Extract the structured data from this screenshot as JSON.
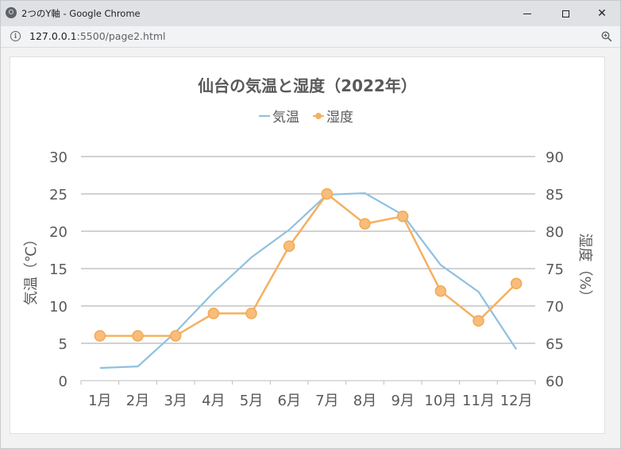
{
  "window": {
    "title": "2つのY軸 - Google Chrome",
    "minimize_glyph": "",
    "close_glyph": "✕"
  },
  "addressbar": {
    "url_host": "127.0.0.1",
    "url_path": ":5500/page2.html",
    "info_glyph": "i",
    "zoom_icon": "zoom-in-icon"
  },
  "chart_data": {
    "type": "line",
    "title": "仙台の気温と湿度（2022年）",
    "categories": [
      "1月",
      "2月",
      "3月",
      "4月",
      "5月",
      "6月",
      "7月",
      "8月",
      "9月",
      "10月",
      "11月",
      "12月"
    ],
    "series": [
      {
        "name": "気温",
        "axis": "left",
        "color": "#8fc0e0",
        "markers": false,
        "values": [
          1.7,
          1.9,
          6.5,
          11.8,
          16.5,
          20.2,
          24.9,
          25.1,
          22.2,
          15.5,
          11.9,
          4.2
        ]
      },
      {
        "name": "湿度",
        "axis": "right",
        "color": "#f5b060",
        "markers": true,
        "values": [
          66,
          66,
          66,
          69,
          69,
          78,
          85,
          81,
          82,
          72,
          68,
          73
        ]
      }
    ],
    "y_left": {
      "label": "気温（℃）",
      "ylim": [
        0,
        30
      ],
      "ticks": [
        0,
        5,
        10,
        15,
        20,
        25,
        30
      ]
    },
    "y_right": {
      "label": "湿度（%）",
      "ylim": [
        60,
        90
      ],
      "ticks": [
        60,
        65,
        70,
        75,
        80,
        85,
        90
      ]
    },
    "grid": true,
    "legend_position": "top-center"
  }
}
